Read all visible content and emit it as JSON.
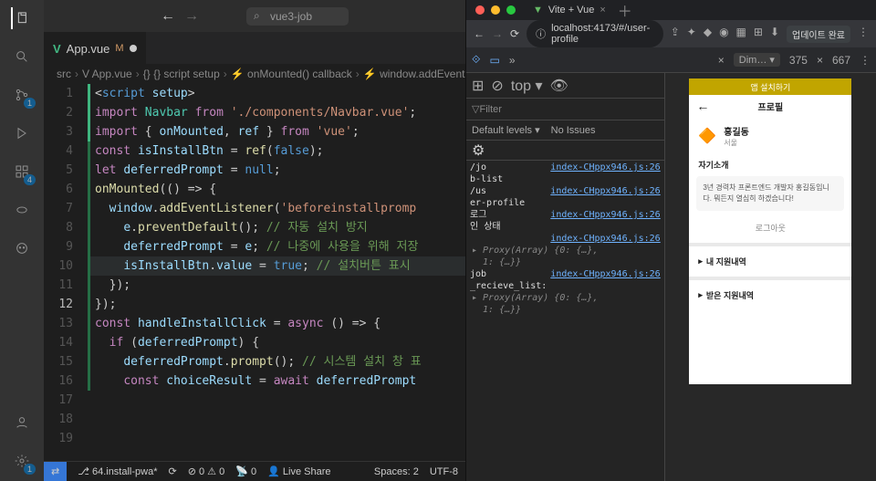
{
  "vscode": {
    "search_placeholder": "vue3-job",
    "tab": {
      "icon_label": "V",
      "filename": "App.vue",
      "modified_marker": "M"
    },
    "breadcrumbs": [
      "src",
      "App.vue",
      "{} script setup",
      "onMounted() callback",
      "window.addEventL"
    ],
    "activity_badges": {
      "scm": "1",
      "ext": "4",
      "settings": "1"
    },
    "gutter_current": 12,
    "lines": [
      {
        "n": 1,
        "bar": "gb1",
        "html": "<span class='tok-punc'>&lt;</span><span class='tok-tag'>script</span> <span class='tok-id'>setup</span><span class='tok-punc'>&gt;</span>"
      },
      {
        "n": 2,
        "bar": "gb1",
        "html": "<span class='tok-kw'>import</span> <span class='tok-type'>Navbar</span> <span class='tok-kw'>from</span> <span class='tok-str'>'./components/Navbar.vue'</span><span class='tok-punc'>;</span>"
      },
      {
        "n": 3,
        "bar": "gb1",
        "html": "<span class='tok-kw'>import</span> <span class='tok-punc'>{</span> <span class='tok-id'>onMounted</span><span class='tok-punc'>,</span> <span class='tok-id'>ref</span> <span class='tok-punc'>}</span> <span class='tok-kw'>from</span> <span class='tok-str'>'vue'</span><span class='tok-punc'>;</span>"
      },
      {
        "n": 4,
        "bar": "",
        "html": ""
      },
      {
        "n": 5,
        "bar": "gb2",
        "html": "<span class='tok-kw'>const</span> <span class='tok-id'>isInstallBtn</span> <span class='tok-punc'>=</span> <span class='tok-fn'>ref</span><span class='tok-punc'>(</span><span class='tok-bool'>false</span><span class='tok-punc'>);</span>"
      },
      {
        "n": 6,
        "bar": "gb2",
        "html": "<span class='tok-kw'>let</span> <span class='tok-id'>deferredPrompt</span> <span class='tok-punc'>=</span> <span class='tok-bool'>null</span><span class='tok-punc'>;</span>"
      },
      {
        "n": 7,
        "bar": "",
        "html": ""
      },
      {
        "n": 8,
        "bar": "gb2",
        "html": "<span class='tok-fn'>onMounted</span><span class='tok-punc'>(() =&gt; {</span>"
      },
      {
        "n": 9,
        "bar": "gb2",
        "html": "  <span class='tok-id'>window</span><span class='tok-punc'>.</span><span class='tok-fn'>addEventListener</span><span class='tok-punc'>(</span><span class='tok-str'>'beforeinstallpromp</span>"
      },
      {
        "n": 10,
        "bar": "gb2",
        "html": "    <span class='tok-id'>e</span><span class='tok-punc'>.</span><span class='tok-fn'>preventDefault</span><span class='tok-punc'>();</span> <span class='tok-cmt'>// 자동 설치 방지</span>"
      },
      {
        "n": 11,
        "bar": "gb2",
        "html": "    <span class='tok-id'>deferredPrompt</span> <span class='tok-punc'>=</span> <span class='tok-id'>e</span><span class='tok-punc'>;</span> <span class='tok-cmt'>// 나중에 사용을 위해 저장</span>"
      },
      {
        "n": 12,
        "bar": "gb2",
        "hl": true,
        "html": "    <span class='tok-id'>isInstallBtn</span><span class='tok-punc'>.</span><span class='tok-id'>value</span> <span class='tok-punc'>=</span> <span class='tok-bool'>true</span><span class='tok-punc'>;</span> <span class='tok-cmt'>// 설치버튼 표시</span>"
      },
      {
        "n": 13,
        "bar": "gb2",
        "html": "  <span class='tok-punc'>});</span>"
      },
      {
        "n": 14,
        "bar": "gb2",
        "html": "<span class='tok-punc'>});</span>"
      },
      {
        "n": 15,
        "bar": "",
        "html": ""
      },
      {
        "n": 16,
        "bar": "gb2",
        "html": "<span class='tok-kw'>const</span> <span class='tok-id'>handleInstallClick</span> <span class='tok-punc'>=</span> <span class='tok-kw'>async</span> <span class='tok-punc'>() =&gt; {</span>"
      },
      {
        "n": 17,
        "bar": "gb2",
        "html": "  <span class='tok-kw'>if</span> <span class='tok-punc'>(</span><span class='tok-id'>deferredPrompt</span><span class='tok-punc'>) {</span>"
      },
      {
        "n": 18,
        "bar": "gb2",
        "html": "    <span class='tok-id'>deferredPrompt</span><span class='tok-punc'>.</span><span class='tok-fn'>prompt</span><span class='tok-punc'>();</span> <span class='tok-cmt'>// 시스템 설치 창 표</span>"
      },
      {
        "n": 19,
        "bar": "gb2",
        "html": "    <span class='tok-kw'>const</span> <span class='tok-id'>choiceResult</span> <span class='tok-punc'>=</span> <span class='tok-kw'>await</span> <span class='tok-id'>deferredPrompt</span>"
      }
    ],
    "statusbar": {
      "branch": "64.install-pwa*",
      "errors": "0",
      "warnings": "0",
      "port": "0",
      "live_share": "Live Share",
      "spaces": "Spaces: 2",
      "encoding": "UTF-8"
    }
  },
  "browser": {
    "tab_title": "Vite + Vue",
    "url": "localhost:4173/#/user-profile",
    "update_label": "업데이트 완료",
    "devtools": {
      "dim_label": "Dim…",
      "width": "375",
      "height": "667",
      "console": {
        "top": "top",
        "filter_label": "Filter",
        "levels": "Default levels",
        "no_issues": "No Issues",
        "entries": [
          {
            "left": "/jo\nb-list",
            "link": "index-CHppx946.js:26"
          },
          {
            "left": "/us\ner-profile",
            "link": "index-CHppx946.js:26"
          },
          {
            "left": "로그\n인 상태",
            "link": "index-CHppx946.js:26"
          },
          {
            "left": "",
            "link": "index-CHppx946.js:26",
            "sub": "▸ Proxy(Array) {0: {…},\n  1: {…}}"
          },
          {
            "left": "job\n_recieve_list:",
            "link": "index-CHppx946.js:26",
            "sub": "▸ Proxy(Array) {0: {…},\n  1: {…}}"
          }
        ]
      }
    },
    "phone": {
      "banner": "앱 설치하기",
      "title": "프로필",
      "name": "홍길동",
      "location": "서울",
      "intro_title": "자기소개",
      "intro_body": "3년 경력차 프론트엔드 개발자 홍길동입니다. 뭐든지 열심히 하겠습니다!",
      "logout": "로그아웃",
      "acc1": "내 지원내역",
      "acc2": "받은 지원내역"
    }
  }
}
